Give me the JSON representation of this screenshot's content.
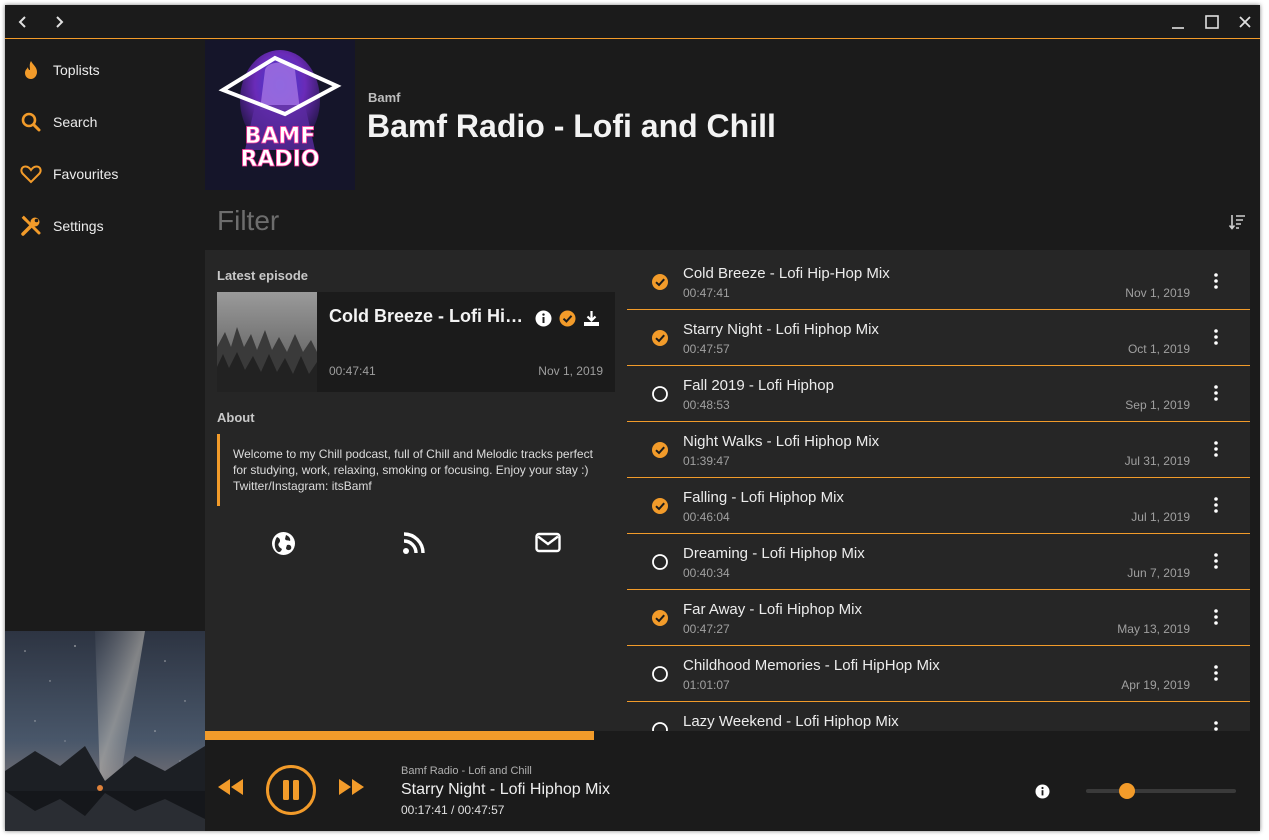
{
  "colors": {
    "accent": "#f29b2a",
    "background": "#1b1b1b",
    "panel": "#262626"
  },
  "titlebar": {
    "icons": [
      "chevron-left-icon",
      "chevron-right-icon",
      "minimize-icon",
      "maximize-icon",
      "close-icon"
    ]
  },
  "sidebar": {
    "items": [
      {
        "label": "Toplists",
        "icon": "fire-icon"
      },
      {
        "label": "Search",
        "icon": "search-icon"
      },
      {
        "label": "Favourites",
        "icon": "heart-icon"
      },
      {
        "label": "Settings",
        "icon": "tools-icon"
      }
    ]
  },
  "podcast": {
    "author": "Bamf",
    "title": "Bamf Radio - Lofi and Chill",
    "cover_text": [
      "BAMF",
      "RADIO"
    ]
  },
  "filter": {
    "placeholder": "Filter"
  },
  "latest": {
    "heading": "Latest episode",
    "title": "Cold Breeze - Lofi Hip-Hop Mix",
    "duration": "00:47:41",
    "date": "Nov 1, 2019"
  },
  "about": {
    "heading": "About",
    "text": "Welcome to my Chill podcast, full of Chill and Melodic tracks perfect\nfor studying, work, relaxing, smoking or focusing. Enjoy your stay :)\nTwitter/Instagram: itsBamf"
  },
  "links": [
    "globe-icon",
    "rss-icon",
    "mail-icon"
  ],
  "episodes": [
    {
      "title": "Cold Breeze - Lofi Hip-Hop Mix",
      "duration": "00:47:41",
      "date": "Nov 1, 2019",
      "played": true
    },
    {
      "title": "Starry Night - Lofi Hiphop Mix",
      "duration": "00:47:57",
      "date": "Oct 1, 2019",
      "played": true
    },
    {
      "title": "Fall 2019 - Lofi Hiphop",
      "duration": "00:48:53",
      "date": "Sep 1, 2019",
      "played": false
    },
    {
      "title": "Night Walks - Lofi Hiphop Mix",
      "duration": "01:39:47",
      "date": "Jul 31, 2019",
      "played": true
    },
    {
      "title": "Falling - Lofi Hiphop Mix",
      "duration": "00:46:04",
      "date": "Jul 1, 2019",
      "played": true
    },
    {
      "title": "Dreaming - Lofi Hiphop Mix",
      "duration": "00:40:34",
      "date": "Jun 7, 2019",
      "played": false
    },
    {
      "title": "Far Away - Lofi Hiphop Mix",
      "duration": "00:47:27",
      "date": "May 13, 2019",
      "played": true
    },
    {
      "title": "Childhood Memories - Lofi HipHop Mix",
      "duration": "01:01:07",
      "date": "Apr 19, 2019",
      "played": false
    },
    {
      "title": "Lazy Weekend - Lofi Hiphop Mix",
      "duration": "",
      "date": "",
      "played": false
    }
  ],
  "player": {
    "podcast": "Bamf Radio - Lofi and Chill",
    "episode": "Starry Night - Lofi Hiphop Mix",
    "time": "00:17:41 / 00:47:57",
    "progress": 0.369,
    "volume": 0.27
  }
}
